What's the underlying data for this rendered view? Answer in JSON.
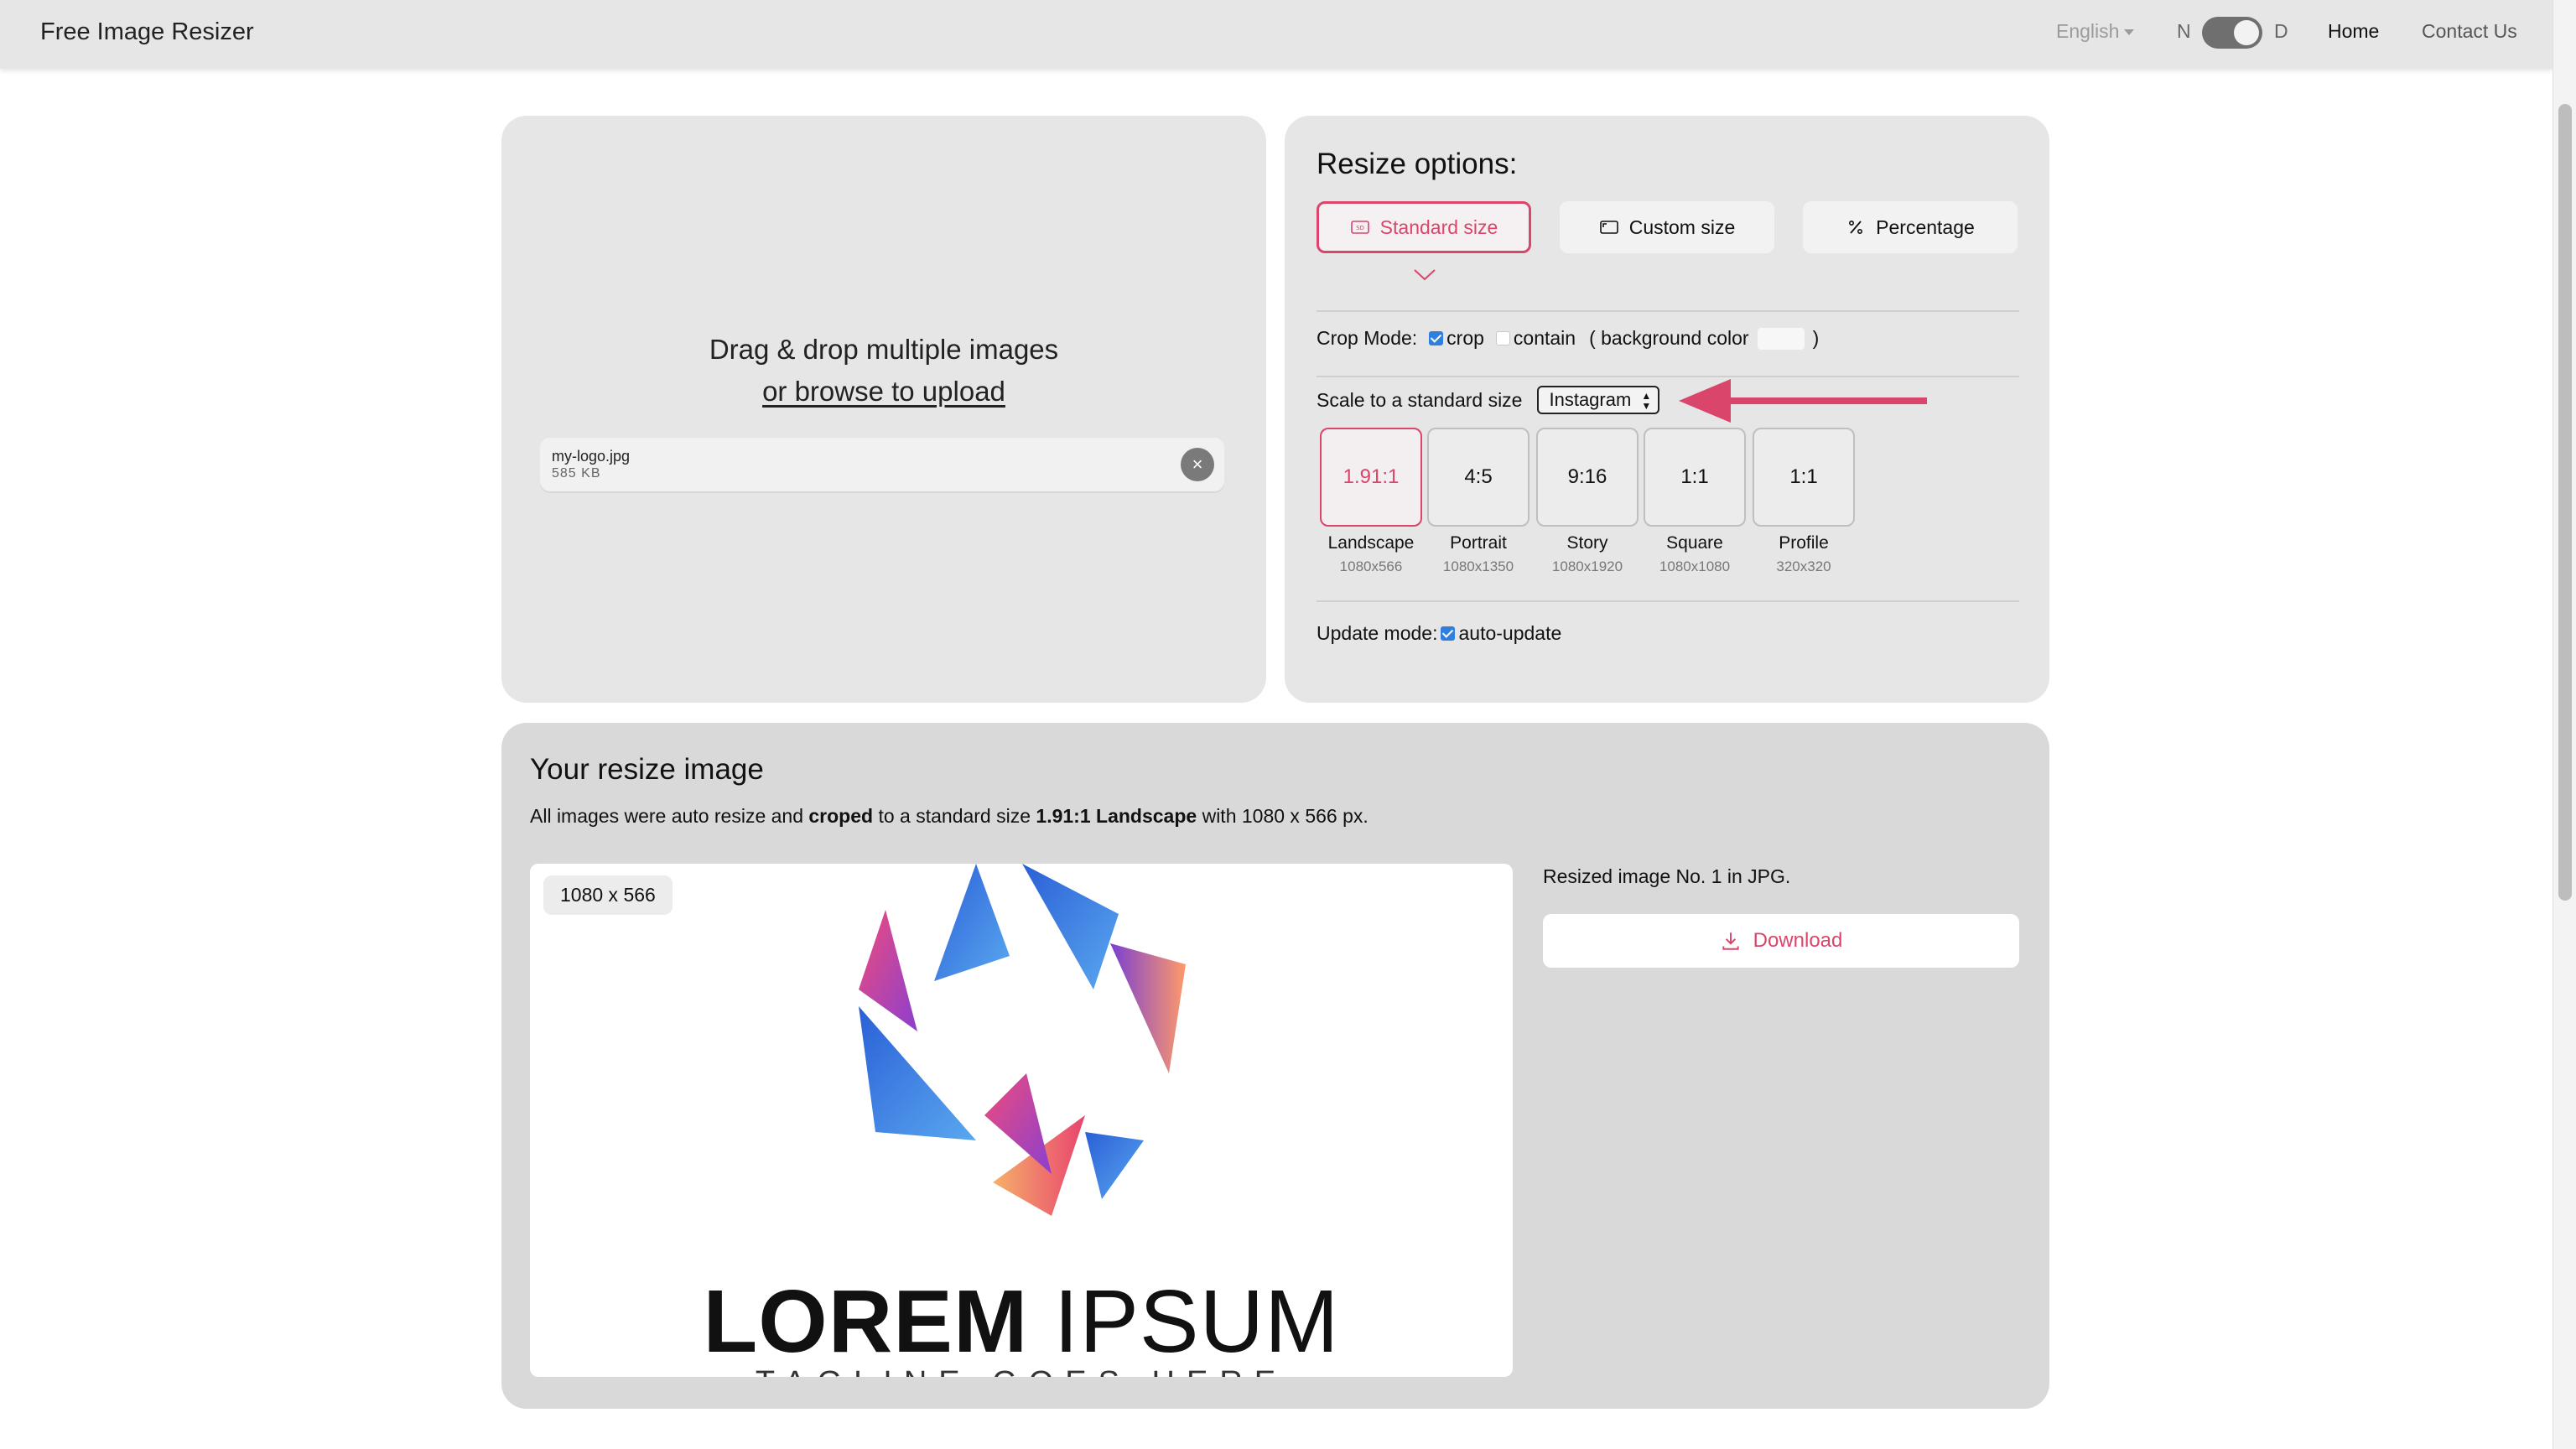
{
  "app": {
    "title": "Free Image Resizer"
  },
  "nav": {
    "language": "English",
    "mode_left": "N",
    "mode_right": "D",
    "home": "Home",
    "contact": "Contact Us"
  },
  "upload": {
    "line1": "Drag & drop multiple images",
    "line2": "or browse to upload",
    "file": {
      "name": "my-logo.jpg",
      "size": "585 KB",
      "remove": "×"
    }
  },
  "options": {
    "title": "Resize options:",
    "modes": [
      {
        "label": "Standard size",
        "icon": "sd-card-icon",
        "active": true
      },
      {
        "label": "Custom size",
        "icon": "aspect-ratio-icon",
        "active": false
      },
      {
        "label": "Percentage",
        "icon": "percent-icon",
        "active": false
      }
    ],
    "crop_mode": {
      "label": "Crop Mode:",
      "crop": "crop",
      "contain": "contain",
      "bg_open": "( background color",
      "bg_close": ")",
      "crop_checked": true,
      "contain_checked": false
    },
    "scale": {
      "label": "Scale to a standard size",
      "selected": "Instagram"
    },
    "ratios": [
      {
        "ratio": "1.91:1",
        "name": "Landscape",
        "dims": "1080x566",
        "active": true
      },
      {
        "ratio": "4:5",
        "name": "Portrait",
        "dims": "1080x1350",
        "active": false
      },
      {
        "ratio": "9:16",
        "name": "Story",
        "dims": "1080x1920",
        "active": false
      },
      {
        "ratio": "1:1",
        "name": "Square",
        "dims": "1080x1080",
        "active": false
      },
      {
        "ratio": "1:1",
        "name": "Profile",
        "dims": "320x320",
        "active": false
      }
    ],
    "update_mode": {
      "label": "Update mode:",
      "option": "auto-update",
      "checked": true
    }
  },
  "result": {
    "title": "Your resize image",
    "desc": {
      "p1": "All images were auto resize and ",
      "b1": "croped",
      "p2": " to a standard size ",
      "b2": "1.91:1 Landscape",
      "p3": " with 1080 x 566 px."
    },
    "badge": "1080 x 566",
    "logo_bold": "LOREM",
    "logo_light": " IPSUM",
    "tagline": "TAGLINE GOES HERE",
    "image_label": "Resized image No. 1 in JPG.",
    "download": "Download"
  },
  "colors": {
    "accent": "#d9456b",
    "checkbox": "#2f7fe0",
    "card": "#e6e6e6"
  }
}
